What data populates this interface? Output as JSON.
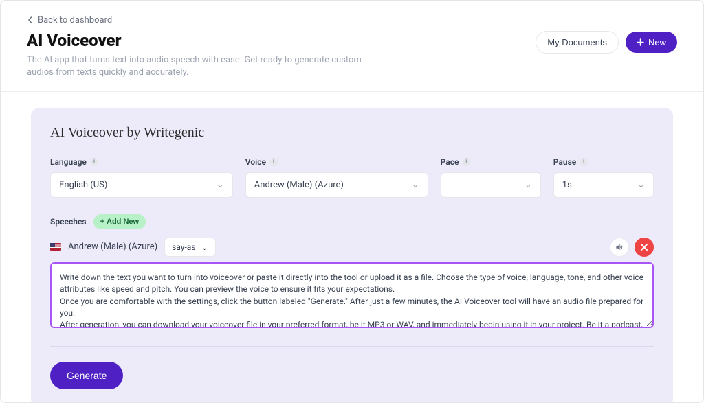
{
  "header": {
    "back": "Back to dashboard",
    "title": "AI Voiceover",
    "subtitle": "The AI app that turns text into audio speech with ease. Get ready to generate custom audios from texts quickly and accurately.",
    "my_documents": "My Documents",
    "new_btn": "New"
  },
  "panel": {
    "title": "AI Voiceover by Writegenic",
    "fields": {
      "language": {
        "label": "Language",
        "value": "English (US)"
      },
      "voice": {
        "label": "Voice",
        "value": "Andrew (Male) (Azure)"
      },
      "pace": {
        "label": "Pace",
        "value": ""
      },
      "pause": {
        "label": "Pause",
        "value": "1s"
      }
    },
    "speeches_label": "Speeches",
    "add_new": "Add New",
    "speech": {
      "voice_name": "Andrew (Male) (Azure)",
      "say_as": "say-as",
      "text": "Write down the text you want to turn into voiceover or paste it directly into the tool or upload it as a file. Choose the type of voice, language, tone, and other voice attributes like speed and pitch. You can preview the voice to ensure it fits your expectations.\nOnce you are comfortable with the settings, click the button labeled \"Generate.\" After just a few minutes, the AI Voiceover tool will have an audio file prepared for you.\nAfter generation, you can download your voiceover file in your preferred format, be it MP3 or WAV, and immediately begin using it in your project. Be it a podcast, a presentation, or a commercial, your voiceover is ready to go live and delight your audience."
    },
    "generate": "Generate"
  }
}
